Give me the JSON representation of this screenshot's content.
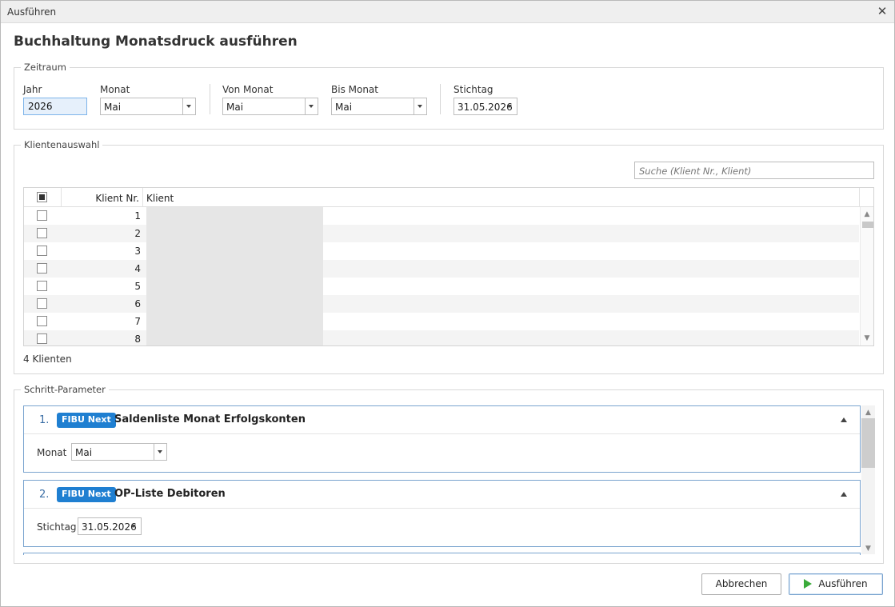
{
  "window": {
    "title": "Ausführen",
    "close_glyph": "✕"
  },
  "heading": "Buchhaltung Monatsdruck ausführen",
  "zeitraum": {
    "legend": "Zeitraum",
    "jahr": {
      "label": "Jahr",
      "value": "2026"
    },
    "monat": {
      "label": "Monat",
      "value": "Mai"
    },
    "von_monat": {
      "label": "Von Monat",
      "value": "Mai"
    },
    "bis_monat": {
      "label": "Bis Monat",
      "value": "Mai"
    },
    "stichtag": {
      "label": "Stichtag",
      "value": "31.05.2026"
    }
  },
  "klienten": {
    "legend": "Klientenauswahl",
    "search_placeholder": "Suche (Klient Nr., Klient)",
    "columns": {
      "nr": "Klient Nr.",
      "klient": "Klient"
    },
    "rows": [
      {
        "nr": "1"
      },
      {
        "nr": "2"
      },
      {
        "nr": "3"
      },
      {
        "nr": "4"
      },
      {
        "nr": "5"
      },
      {
        "nr": "6"
      },
      {
        "nr": "7"
      },
      {
        "nr": "8"
      }
    ],
    "count_text": "4 Klienten"
  },
  "schritte": {
    "legend": "Schritt-Parameter",
    "steps": [
      {
        "number": "1.",
        "badge": "FIBU Next",
        "title": "Saldenliste Monat Erfolgskonten",
        "param_label": "Monat",
        "param_value": "Mai"
      },
      {
        "number": "2.",
        "badge": "FIBU Next",
        "title": "OP-Liste Debitoren",
        "param_label": "Stichtag",
        "param_value": "31.05.2026"
      }
    ]
  },
  "buttons": {
    "cancel": "Abbrechen",
    "run": "Ausführen"
  },
  "colors": {
    "accent": "#1f7fd1",
    "run_icon": "#3aab3a",
    "card_border": "#7aa4cf"
  },
  "icons": {
    "close": "close-icon",
    "dropdown": "chevron-down-icon",
    "collapse": "chevron-up-icon",
    "run": "play-icon"
  }
}
